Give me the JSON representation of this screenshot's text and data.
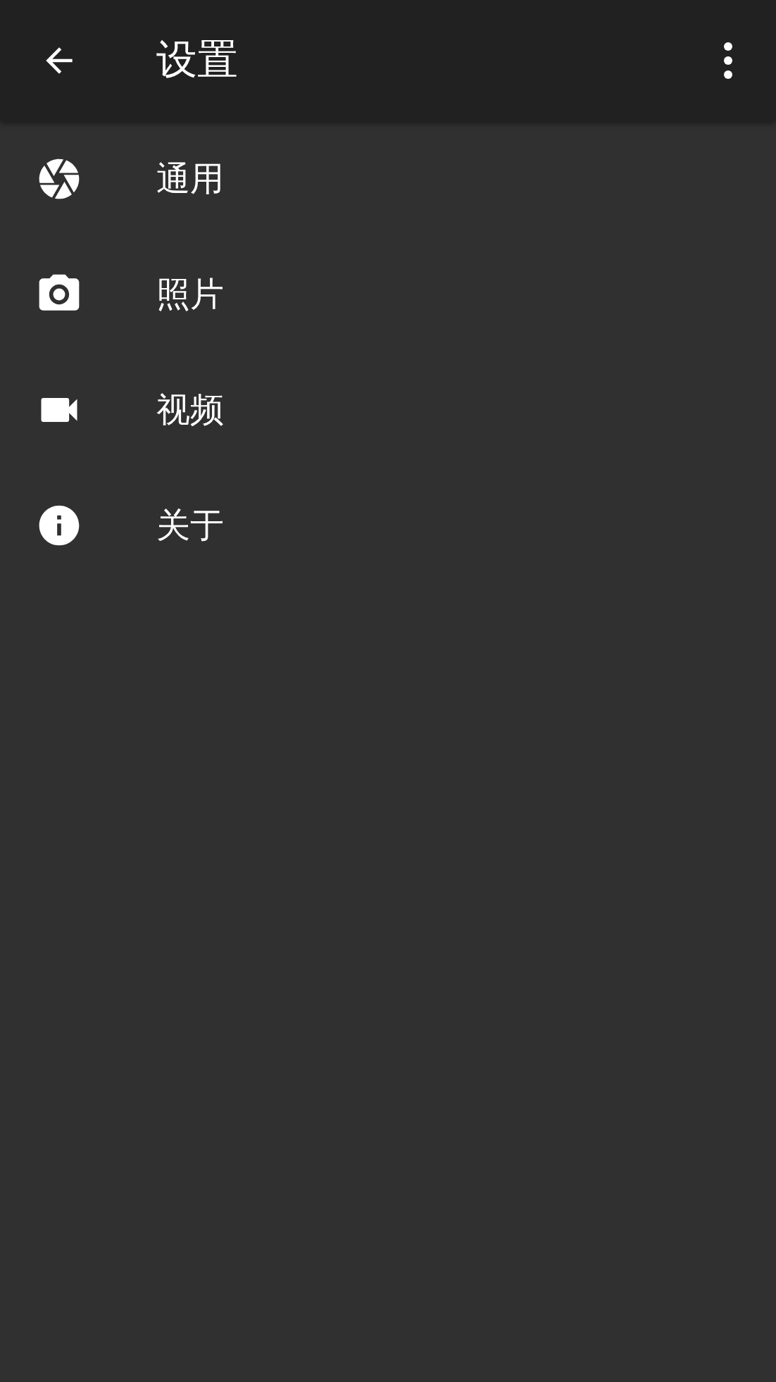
{
  "app_bar": {
    "title": "设置"
  },
  "items": [
    {
      "kind": "aperture",
      "label": "通用"
    },
    {
      "kind": "camera",
      "label": "照片"
    },
    {
      "kind": "video",
      "label": "视频"
    },
    {
      "kind": "info",
      "label": "关于"
    }
  ]
}
